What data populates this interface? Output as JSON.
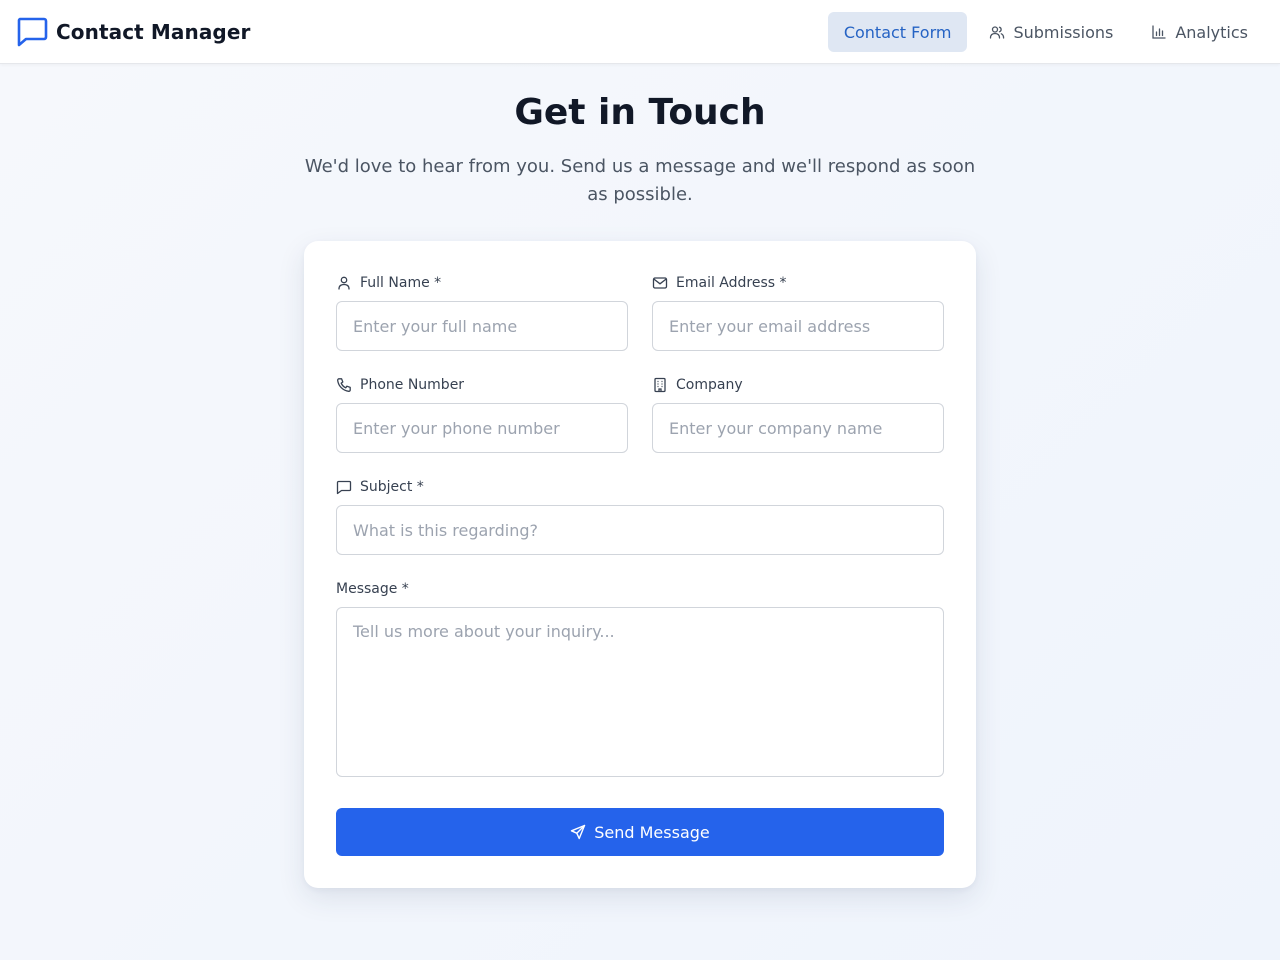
{
  "app": {
    "title": "Contact Manager"
  },
  "nav": {
    "items": [
      {
        "label": "Contact Form",
        "icon": "none",
        "active": true
      },
      {
        "label": "Submissions",
        "icon": "users-icon",
        "active": false
      },
      {
        "label": "Analytics",
        "icon": "bar-chart-icon",
        "active": false
      }
    ]
  },
  "hero": {
    "title": "Get in Touch",
    "subtitle": "We'd love to hear from you. Send us a message and we'll respond as soon as possible."
  },
  "form": {
    "full_name": {
      "label": "Full Name *",
      "placeholder": "Enter your full name",
      "value": ""
    },
    "email": {
      "label": "Email Address *",
      "placeholder": "Enter your email address",
      "value": ""
    },
    "phone": {
      "label": "Phone Number",
      "placeholder": "Enter your phone number",
      "value": ""
    },
    "company": {
      "label": "Company",
      "placeholder": "Enter your company name",
      "value": ""
    },
    "subject": {
      "label": "Subject *",
      "placeholder": "What is this regarding?",
      "value": ""
    },
    "message": {
      "label": "Message *",
      "placeholder": "Tell us more about your inquiry...",
      "value": ""
    },
    "submit_label": "Send Message"
  },
  "colors": {
    "accent": "#2563eb",
    "nav_active_bg": "#dfe7f3",
    "nav_active_text": "#2563c4",
    "text_primary": "#111827",
    "text_secondary": "#4b5563"
  }
}
